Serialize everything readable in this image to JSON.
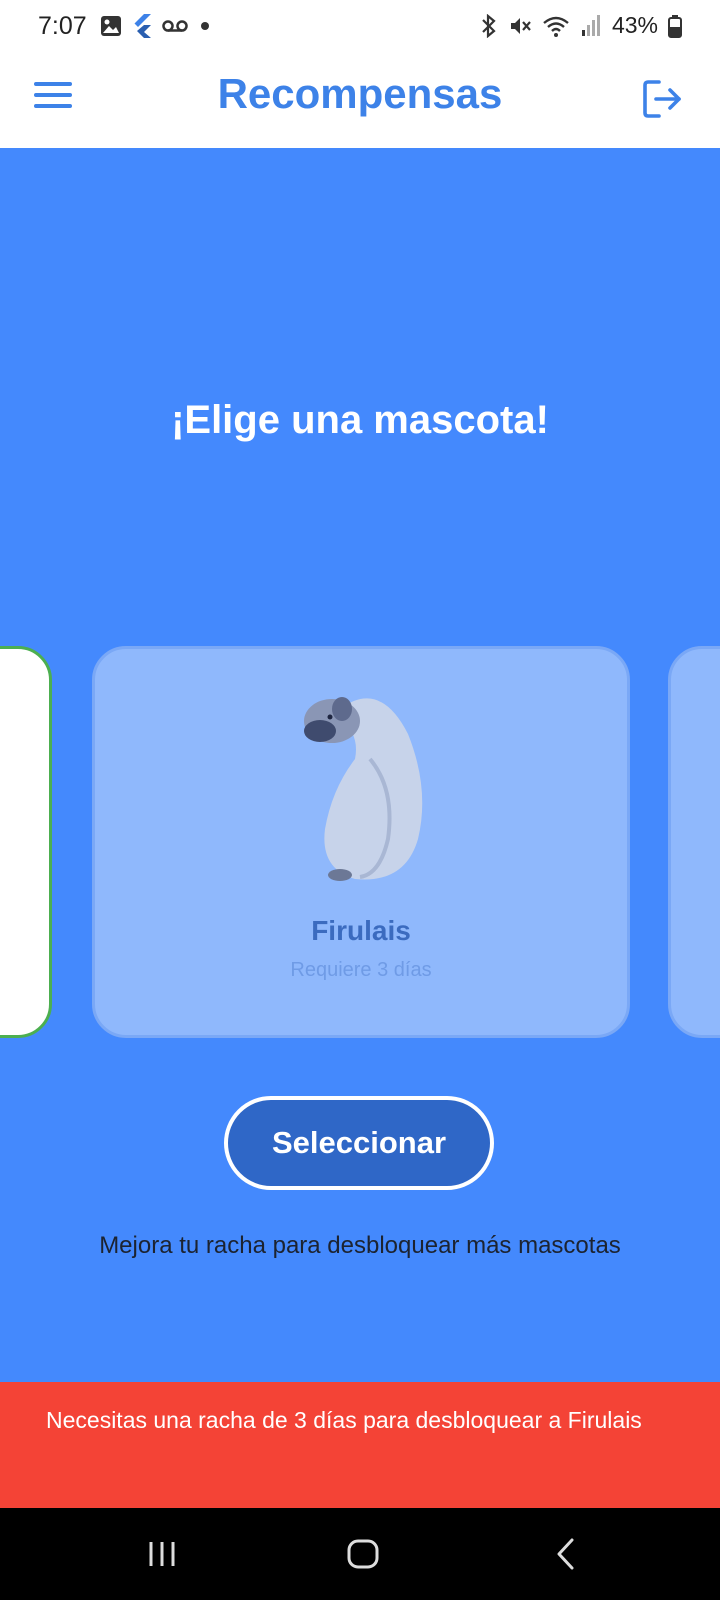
{
  "status_bar": {
    "time": "7:07",
    "battery": "43%",
    "left_icons": [
      "image-icon",
      "flutter-icon",
      "voicemail-icon",
      "dot-icon"
    ],
    "right_icons": [
      "bluetooth-icon",
      "mute-icon",
      "wifi-icon",
      "signal-icon",
      "battery-icon"
    ]
  },
  "app_bar": {
    "title": "Recompensas",
    "menu_icon": "hamburger-menu-icon",
    "logout_icon": "logout-icon"
  },
  "main": {
    "headline": "¡Elige una mascota!",
    "selected_pet": {
      "name": "Firulais",
      "requirement": "Requiere 3 días"
    },
    "select_button": "Seleccionar",
    "hint": "Mejora tu racha para desbloquear más mascotas"
  },
  "snackbar": {
    "message": "Necesitas una racha de 3 días para desbloquear a Firulais"
  },
  "nav_bar": {
    "icons": [
      "recent-apps-icon",
      "home-icon",
      "back-icon"
    ]
  },
  "colors": {
    "accent": "#3d82e8",
    "background": "#4489fd",
    "card_locked": "#8fb8fc",
    "card_unlocked_border": "#4caf50",
    "button": "#2f67c7",
    "snackbar": "#f44336"
  }
}
